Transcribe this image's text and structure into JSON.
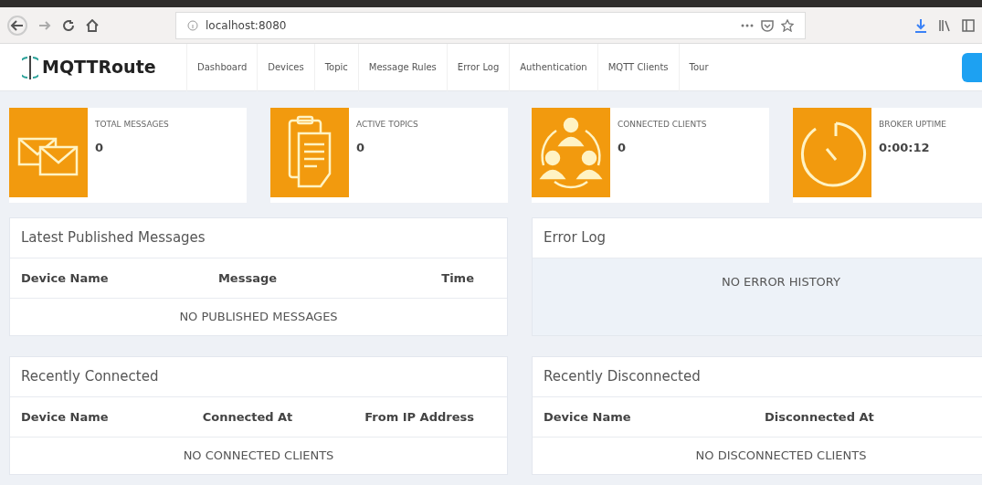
{
  "browser": {
    "url": "localhost:8080"
  },
  "brand": {
    "name": "MQTTRoute"
  },
  "nav": [
    {
      "label": "Dashboard"
    },
    {
      "label": "Devices"
    },
    {
      "label": "Topic"
    },
    {
      "label": "Message Rules"
    },
    {
      "label": "Error Log"
    },
    {
      "label": "Authentication"
    },
    {
      "label": "MQTT Clients"
    },
    {
      "label": "Tour"
    }
  ],
  "stats": [
    {
      "kind": "messages",
      "label": "TOTAL MESSAGES",
      "value": "0"
    },
    {
      "kind": "topics",
      "label": "ACTIVE TOPICS",
      "value": "0"
    },
    {
      "kind": "clients",
      "label": "CONNECTED CLIENTS",
      "value": "0"
    },
    {
      "kind": "uptime",
      "label": "BROKER UPTIME",
      "value": "0:00:12"
    }
  ],
  "panels": [
    {
      "title": "Latest Published Messages",
      "columns": [
        "Device Name",
        "Message",
        "Time"
      ],
      "empty": "NO PUBLISHED MESSAGES"
    },
    {
      "title": "Error Log",
      "empty": "NO ERROR HISTORY"
    },
    {
      "title": "Recently Connected",
      "columns": [
        "Device Name",
        "Connected At",
        "From IP Address"
      ],
      "empty": "NO CONNECTED CLIENTS"
    },
    {
      "title": "Recently Disconnected",
      "columns": [
        "Device Name",
        "Disconnected At"
      ],
      "empty": "NO DISCONNECTED CLIENTS"
    }
  ]
}
